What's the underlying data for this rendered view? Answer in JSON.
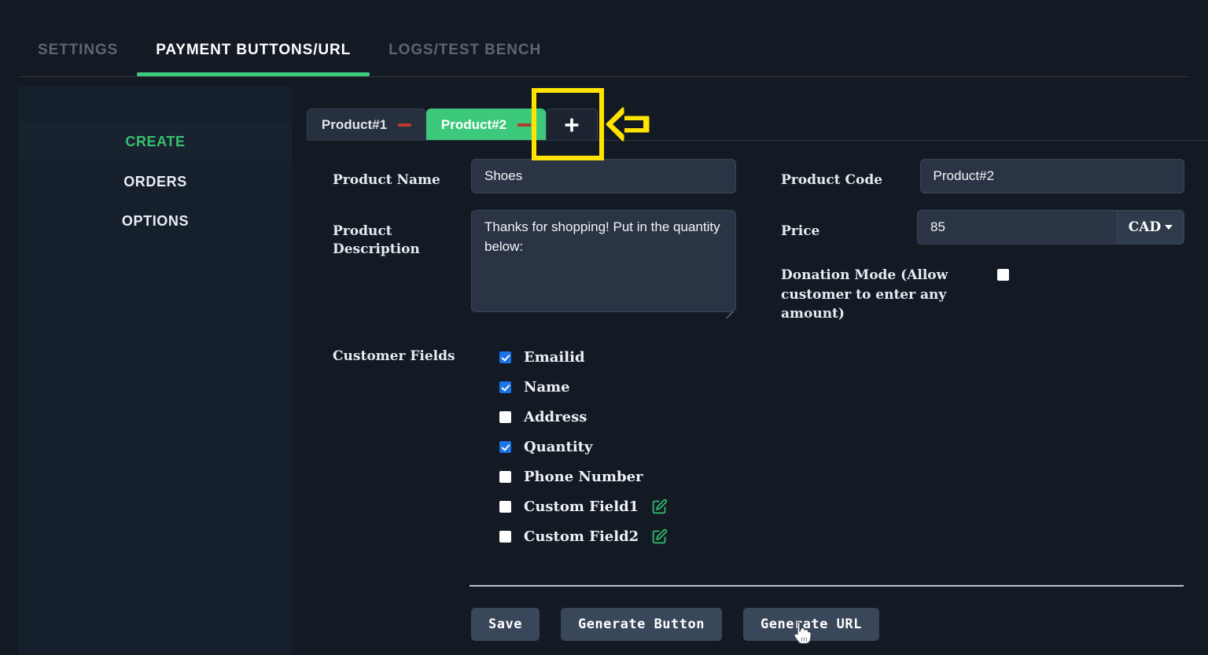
{
  "app": {
    "top_tabs": [
      {
        "label": "SETTINGS",
        "active": false
      },
      {
        "label": "PAYMENT BUTTONS/URL",
        "active": true
      },
      {
        "label": "LOGS/TEST BENCH",
        "active": false
      }
    ],
    "accent_green": "#3ecb80",
    "highlight_yellow": "#ffe400"
  },
  "sidebar": {
    "items": [
      {
        "label": "CREATE",
        "active": true
      },
      {
        "label": "ORDERS",
        "active": false
      },
      {
        "label": "OPTIONS",
        "active": false
      }
    ]
  },
  "product_tabs": {
    "tabs": [
      {
        "label": "Product#1",
        "selected": false,
        "remove_icon": "minus-icon"
      },
      {
        "label": "Product#2",
        "selected": true,
        "remove_icon": "minus-icon"
      }
    ],
    "add_button": {
      "icon": "plus-icon",
      "label": "+"
    }
  },
  "annotation": {
    "highlight_target": "add-product-tab-button",
    "arrow_icon": "left-arrow-icon"
  },
  "form": {
    "product_name": {
      "label": "Product Name",
      "value": "Shoes",
      "placeholder": "Product Name"
    },
    "product_description": {
      "label": "Product Description",
      "value": "Thanks for shopping! Put in the quantity below:",
      "placeholder": "Product Description"
    },
    "product_code": {
      "label": "Product Code",
      "value": "Product#2",
      "placeholder": "Product Code"
    },
    "price": {
      "label": "Price",
      "value": "85",
      "placeholder": "Price",
      "currency": "CAD",
      "currency_icon": "chevron-down-icon"
    },
    "donation_mode": {
      "label": "Donation Mode (Allow customer to enter any amount)",
      "checked": false
    },
    "customer_fields": {
      "label": "Customer Fields",
      "items": [
        {
          "label": "Emailid",
          "checked": true,
          "editable": false
        },
        {
          "label": "Name",
          "checked": true,
          "editable": false
        },
        {
          "label": "Address",
          "checked": false,
          "editable": false
        },
        {
          "label": "Quantity",
          "checked": true,
          "editable": false
        },
        {
          "label": "Phone Number",
          "checked": false,
          "editable": false
        },
        {
          "label": "Custom Field1",
          "checked": false,
          "editable": true,
          "edit_icon": "edit-pencil-icon"
        },
        {
          "label": "Custom Field2",
          "checked": false,
          "editable": true,
          "edit_icon": "edit-pencil-icon"
        }
      ]
    }
  },
  "actions": {
    "save": "Save",
    "generate_button": "Generate Button",
    "generate_url": "Generate URL"
  },
  "cursor": {
    "type": "pointer-hand",
    "over": "generate-url-button"
  }
}
